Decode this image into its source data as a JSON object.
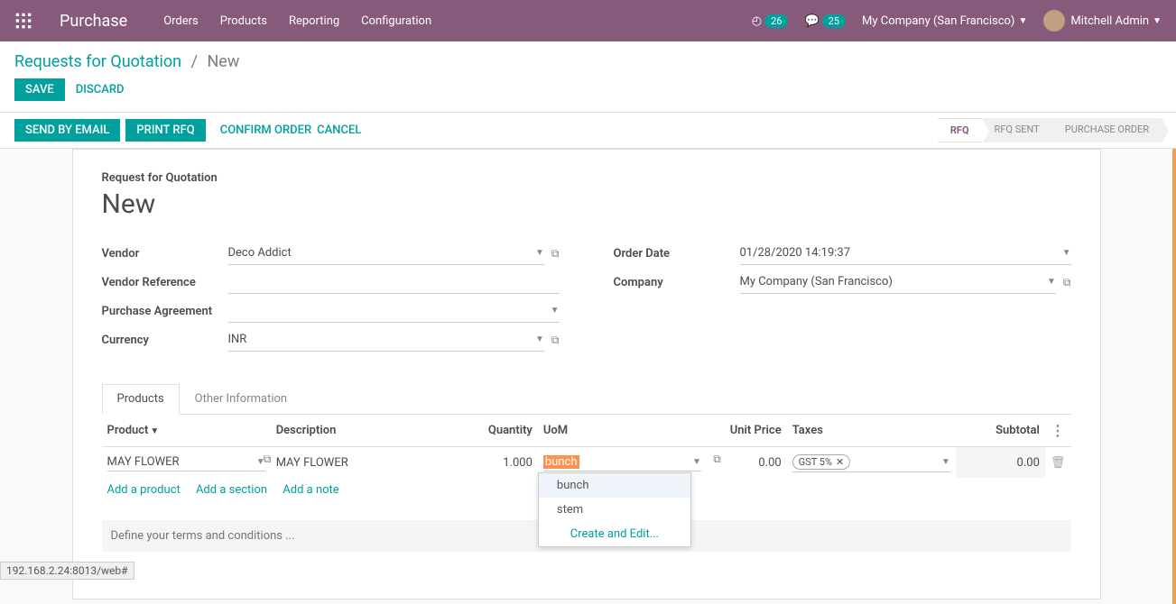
{
  "topnav": {
    "app_title": "Purchase",
    "menu": [
      "Orders",
      "Products",
      "Reporting",
      "Configuration"
    ],
    "activity_count": "26",
    "messages_count": "25",
    "company": "My Company (San Francisco)",
    "user": "Mitchell Admin"
  },
  "breadcrumb": {
    "root": "Requests for Quotation",
    "current": "New"
  },
  "buttons": {
    "save": "SAVE",
    "discard": "DISCARD",
    "send_email": "SEND BY EMAIL",
    "print_rfq": "PRINT RFQ",
    "confirm": "CONFIRM ORDER",
    "cancel": "CANCEL"
  },
  "status_stages": [
    "RFQ",
    "RFQ SENT",
    "PURCHASE ORDER"
  ],
  "sheet": {
    "small_title": "Request for Quotation",
    "title": "New"
  },
  "fields": {
    "vendor_label": "Vendor",
    "vendor_value": "Deco Addict",
    "vendor_ref_label": "Vendor Reference",
    "vendor_ref_value": "",
    "agreement_label": "Purchase Agreement",
    "agreement_value": "",
    "currency_label": "Currency",
    "currency_value": "INR",
    "order_date_label": "Order Date",
    "order_date_value": "01/28/2020 14:19:37",
    "company_label": "Company",
    "company_value": "My Company (San Francisco)"
  },
  "tabs": {
    "products": "Products",
    "other": "Other Information"
  },
  "table": {
    "headers": {
      "product": "Product",
      "description": "Description",
      "quantity": "Quantity",
      "uom": "UoM",
      "unit_price": "Unit Price",
      "taxes": "Taxes",
      "subtotal": "Subtotal"
    },
    "rows": [
      {
        "product": "MAY FLOWER",
        "description": "MAY FLOWER",
        "quantity": "1.000",
        "uom": "bunch",
        "unit_price": "0.00",
        "tax": "GST 5%",
        "subtotal": "0.00"
      }
    ],
    "add_product": "Add a product",
    "add_section": "Add a section",
    "add_note": "Add a note"
  },
  "uom_dropdown": {
    "options": [
      "bunch",
      "stem"
    ],
    "create_edit": "Create and Edit..."
  },
  "terms_placeholder": "Define your terms and conditions ...",
  "status_url": "192.168.2.24:8013/web#"
}
